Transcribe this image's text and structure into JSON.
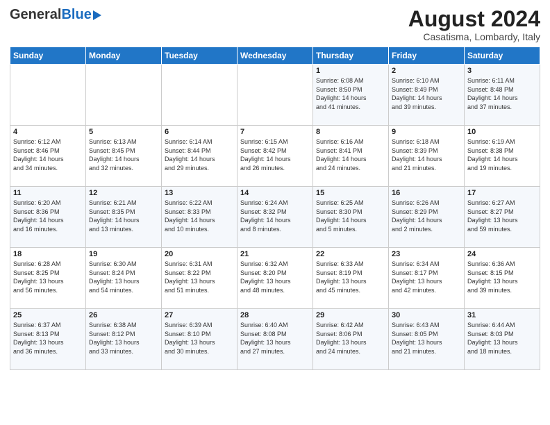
{
  "header": {
    "logo_line1": "General",
    "logo_line2": "Blue",
    "month_title": "August 2024",
    "location": "Casatisma, Lombardy, Italy"
  },
  "weekdays": [
    "Sunday",
    "Monday",
    "Tuesday",
    "Wednesday",
    "Thursday",
    "Friday",
    "Saturday"
  ],
  "weeks": [
    [
      {
        "day": "",
        "info": ""
      },
      {
        "day": "",
        "info": ""
      },
      {
        "day": "",
        "info": ""
      },
      {
        "day": "",
        "info": ""
      },
      {
        "day": "1",
        "info": "Sunrise: 6:08 AM\nSunset: 8:50 PM\nDaylight: 14 hours\nand 41 minutes."
      },
      {
        "day": "2",
        "info": "Sunrise: 6:10 AM\nSunset: 8:49 PM\nDaylight: 14 hours\nand 39 minutes."
      },
      {
        "day": "3",
        "info": "Sunrise: 6:11 AM\nSunset: 8:48 PM\nDaylight: 14 hours\nand 37 minutes."
      }
    ],
    [
      {
        "day": "4",
        "info": "Sunrise: 6:12 AM\nSunset: 8:46 PM\nDaylight: 14 hours\nand 34 minutes."
      },
      {
        "day": "5",
        "info": "Sunrise: 6:13 AM\nSunset: 8:45 PM\nDaylight: 14 hours\nand 32 minutes."
      },
      {
        "day": "6",
        "info": "Sunrise: 6:14 AM\nSunset: 8:44 PM\nDaylight: 14 hours\nand 29 minutes."
      },
      {
        "day": "7",
        "info": "Sunrise: 6:15 AM\nSunset: 8:42 PM\nDaylight: 14 hours\nand 26 minutes."
      },
      {
        "day": "8",
        "info": "Sunrise: 6:16 AM\nSunset: 8:41 PM\nDaylight: 14 hours\nand 24 minutes."
      },
      {
        "day": "9",
        "info": "Sunrise: 6:18 AM\nSunset: 8:39 PM\nDaylight: 14 hours\nand 21 minutes."
      },
      {
        "day": "10",
        "info": "Sunrise: 6:19 AM\nSunset: 8:38 PM\nDaylight: 14 hours\nand 19 minutes."
      }
    ],
    [
      {
        "day": "11",
        "info": "Sunrise: 6:20 AM\nSunset: 8:36 PM\nDaylight: 14 hours\nand 16 minutes."
      },
      {
        "day": "12",
        "info": "Sunrise: 6:21 AM\nSunset: 8:35 PM\nDaylight: 14 hours\nand 13 minutes."
      },
      {
        "day": "13",
        "info": "Sunrise: 6:22 AM\nSunset: 8:33 PM\nDaylight: 14 hours\nand 10 minutes."
      },
      {
        "day": "14",
        "info": "Sunrise: 6:24 AM\nSunset: 8:32 PM\nDaylight: 14 hours\nand 8 minutes."
      },
      {
        "day": "15",
        "info": "Sunrise: 6:25 AM\nSunset: 8:30 PM\nDaylight: 14 hours\nand 5 minutes."
      },
      {
        "day": "16",
        "info": "Sunrise: 6:26 AM\nSunset: 8:29 PM\nDaylight: 14 hours\nand 2 minutes."
      },
      {
        "day": "17",
        "info": "Sunrise: 6:27 AM\nSunset: 8:27 PM\nDaylight: 13 hours\nand 59 minutes."
      }
    ],
    [
      {
        "day": "18",
        "info": "Sunrise: 6:28 AM\nSunset: 8:25 PM\nDaylight: 13 hours\nand 56 minutes."
      },
      {
        "day": "19",
        "info": "Sunrise: 6:30 AM\nSunset: 8:24 PM\nDaylight: 13 hours\nand 54 minutes."
      },
      {
        "day": "20",
        "info": "Sunrise: 6:31 AM\nSunset: 8:22 PM\nDaylight: 13 hours\nand 51 minutes."
      },
      {
        "day": "21",
        "info": "Sunrise: 6:32 AM\nSunset: 8:20 PM\nDaylight: 13 hours\nand 48 minutes."
      },
      {
        "day": "22",
        "info": "Sunrise: 6:33 AM\nSunset: 8:19 PM\nDaylight: 13 hours\nand 45 minutes."
      },
      {
        "day": "23",
        "info": "Sunrise: 6:34 AM\nSunset: 8:17 PM\nDaylight: 13 hours\nand 42 minutes."
      },
      {
        "day": "24",
        "info": "Sunrise: 6:36 AM\nSunset: 8:15 PM\nDaylight: 13 hours\nand 39 minutes."
      }
    ],
    [
      {
        "day": "25",
        "info": "Sunrise: 6:37 AM\nSunset: 8:13 PM\nDaylight: 13 hours\nand 36 minutes."
      },
      {
        "day": "26",
        "info": "Sunrise: 6:38 AM\nSunset: 8:12 PM\nDaylight: 13 hours\nand 33 minutes."
      },
      {
        "day": "27",
        "info": "Sunrise: 6:39 AM\nSunset: 8:10 PM\nDaylight: 13 hours\nand 30 minutes."
      },
      {
        "day": "28",
        "info": "Sunrise: 6:40 AM\nSunset: 8:08 PM\nDaylight: 13 hours\nand 27 minutes."
      },
      {
        "day": "29",
        "info": "Sunrise: 6:42 AM\nSunset: 8:06 PM\nDaylight: 13 hours\nand 24 minutes."
      },
      {
        "day": "30",
        "info": "Sunrise: 6:43 AM\nSunset: 8:05 PM\nDaylight: 13 hours\nand 21 minutes."
      },
      {
        "day": "31",
        "info": "Sunrise: 6:44 AM\nSunset: 8:03 PM\nDaylight: 13 hours\nand 18 minutes."
      }
    ]
  ]
}
